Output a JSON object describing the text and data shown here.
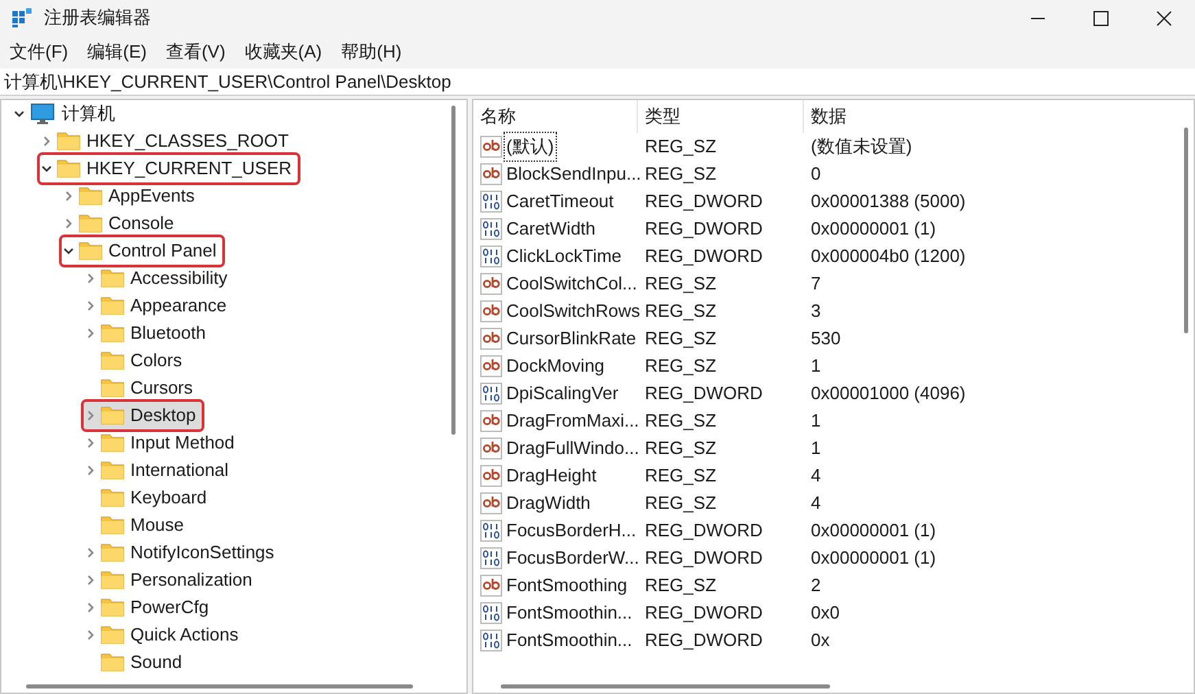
{
  "window": {
    "title": "注册表编辑器"
  },
  "menu": [
    "文件(F)",
    "编辑(E)",
    "查看(V)",
    "收藏夹(A)",
    "帮助(H)"
  ],
  "address": "计算机\\HKEY_CURRENT_USER\\Control Panel\\Desktop",
  "tree": {
    "label": "计算机",
    "expanded": true,
    "children": [
      {
        "label": "HKEY_CLASSES_ROOT",
        "kind": "branch",
        "expanded": false,
        "selected": false,
        "highlighted": false
      },
      {
        "label": "HKEY_CURRENT_USER",
        "kind": "branch",
        "expanded": true,
        "selected": false,
        "highlighted": true,
        "children": [
          {
            "label": "AppEvents",
            "kind": "branch",
            "expanded": false,
            "selected": false,
            "highlighted": false
          },
          {
            "label": "Console",
            "kind": "branch",
            "expanded": false,
            "selected": false,
            "highlighted": false
          },
          {
            "label": "Control Panel",
            "kind": "branch",
            "expanded": true,
            "selected": false,
            "highlighted": true,
            "children": [
              {
                "label": "Accessibility",
                "kind": "branch",
                "expanded": false,
                "selected": false,
                "highlighted": false
              },
              {
                "label": "Appearance",
                "kind": "branch",
                "expanded": false,
                "selected": false,
                "highlighted": false
              },
              {
                "label": "Bluetooth",
                "kind": "branch",
                "expanded": false,
                "selected": false,
                "highlighted": false
              },
              {
                "label": "Colors",
                "kind": "leaf",
                "selected": false,
                "highlighted": false
              },
              {
                "label": "Cursors",
                "kind": "leaf",
                "selected": false,
                "highlighted": false
              },
              {
                "label": "Desktop",
                "kind": "branch",
                "expanded": false,
                "selected": true,
                "highlighted": true
              },
              {
                "label": "Input Method",
                "kind": "branch",
                "expanded": false,
                "selected": false,
                "highlighted": false
              },
              {
                "label": "International",
                "kind": "branch",
                "expanded": false,
                "selected": false,
                "highlighted": false
              },
              {
                "label": "Keyboard",
                "kind": "leaf",
                "selected": false,
                "highlighted": false
              },
              {
                "label": "Mouse",
                "kind": "leaf",
                "selected": false,
                "highlighted": false
              },
              {
                "label": "NotifyIconSettings",
                "kind": "branch",
                "expanded": false,
                "selected": false,
                "highlighted": false
              },
              {
                "label": "Personalization",
                "kind": "branch",
                "expanded": false,
                "selected": false,
                "highlighted": false
              },
              {
                "label": "PowerCfg",
                "kind": "branch",
                "expanded": false,
                "selected": false,
                "highlighted": false
              },
              {
                "label": "Quick Actions",
                "kind": "branch",
                "expanded": false,
                "selected": false,
                "highlighted": false
              },
              {
                "label": "Sound",
                "kind": "leaf",
                "selected": false,
                "highlighted": false
              }
            ]
          }
        ]
      }
    ]
  },
  "table": {
    "columns": [
      "名称",
      "类型",
      "数据"
    ],
    "rows": [
      {
        "kind": "string",
        "focused": true,
        "name": "(默认)",
        "type": "REG_SZ",
        "data": "(数值未设置)"
      },
      {
        "kind": "string",
        "focused": false,
        "name": "BlockSendInpu...",
        "type": "REG_SZ",
        "data": "0"
      },
      {
        "kind": "binary",
        "focused": false,
        "name": "CaretTimeout",
        "type": "REG_DWORD",
        "data": "0x00001388 (5000)"
      },
      {
        "kind": "binary",
        "focused": false,
        "name": "CaretWidth",
        "type": "REG_DWORD",
        "data": "0x00000001 (1)"
      },
      {
        "kind": "binary",
        "focused": false,
        "name": "ClickLockTime",
        "type": "REG_DWORD",
        "data": "0x000004b0 (1200)"
      },
      {
        "kind": "string",
        "focused": false,
        "name": "CoolSwitchCol...",
        "type": "REG_SZ",
        "data": "7"
      },
      {
        "kind": "string",
        "focused": false,
        "name": "CoolSwitchRows",
        "type": "REG_SZ",
        "data": "3"
      },
      {
        "kind": "string",
        "focused": false,
        "name": "CursorBlinkRate",
        "type": "REG_SZ",
        "data": "530"
      },
      {
        "kind": "string",
        "focused": false,
        "name": "DockMoving",
        "type": "REG_SZ",
        "data": "1"
      },
      {
        "kind": "binary",
        "focused": false,
        "name": "DpiScalingVer",
        "type": "REG_DWORD",
        "data": "0x00001000 (4096)"
      },
      {
        "kind": "string",
        "focused": false,
        "name": "DragFromMaxi...",
        "type": "REG_SZ",
        "data": "1"
      },
      {
        "kind": "string",
        "focused": false,
        "name": "DragFullWindo...",
        "type": "REG_SZ",
        "data": "1"
      },
      {
        "kind": "string",
        "focused": false,
        "name": "DragHeight",
        "type": "REG_SZ",
        "data": "4"
      },
      {
        "kind": "string",
        "focused": false,
        "name": "DragWidth",
        "type": "REG_SZ",
        "data": "4"
      },
      {
        "kind": "binary",
        "focused": false,
        "name": "FocusBorderH...",
        "type": "REG_DWORD",
        "data": "0x00000001 (1)"
      },
      {
        "kind": "binary",
        "focused": false,
        "name": "FocusBorderW...",
        "type": "REG_DWORD",
        "data": "0x00000001 (1)"
      },
      {
        "kind": "string",
        "focused": false,
        "name": "FontSmoothing",
        "type": "REG_SZ",
        "data": "2"
      },
      {
        "kind": "binary",
        "focused": false,
        "name": "FontSmoothin...",
        "type": "REG_DWORD",
        "data": "0x0"
      },
      {
        "kind": "binary",
        "focused": false,
        "name": "FontSmoothin...",
        "type": "REG_DWORD",
        "data": "0x"
      }
    ]
  }
}
